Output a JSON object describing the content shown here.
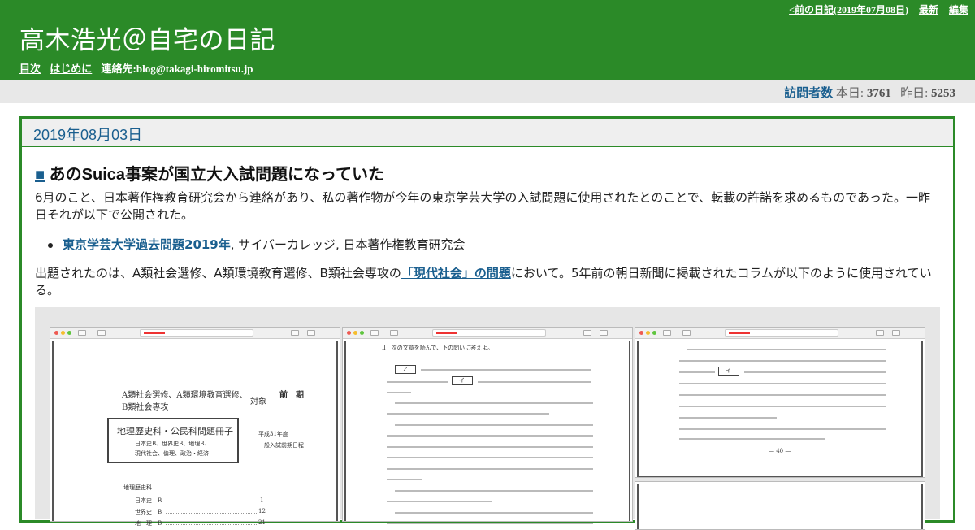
{
  "header": {
    "title": "高木浩光＠自宅の日記",
    "links": [
      "目次",
      "はじめに"
    ],
    "contact": "連絡先:blog@takagi-hiromitsu.jp",
    "nav": [
      "<前の日記(2019年07月08日)",
      "最新",
      "編集"
    ]
  },
  "counter": {
    "label": "訪問者数",
    "today_label": "本日:",
    "today": "3761",
    "yesterday_label": "昨日:",
    "yesterday": "5253"
  },
  "diary": {
    "date": "2019年08月03日",
    "section_mark": "■",
    "section_title": "あのSuica事案が国立大入試問題になっていた",
    "para1": "6月のこと、日本著作権教育研究会から連絡があり、私の著作物が今年の東京学芸大学の入試問題に使用されたとのことで、転載の許諾を求めるものであった。一昨日それが以下で公開された。",
    "bullet_link": "東京学芸大学過去問題2019年",
    "bullet_rest": ", サイバーカレッジ, 日本著作権教育研究会",
    "para2_before": "出題されたのは、A類社会選修、A類環境教育選修、B類社会専攻の",
    "para2_link": "「現代社会」の問題",
    "para2_after": "において。5年前の朝日新聞に掲載されたコラムが以下のように使用されている。"
  },
  "scan": {
    "left_heading_1": "A類社会選修、A類環境教育選修、",
    "left_heading_2": "B類社会専攻",
    "left_target": "対象",
    "left_term": "前　期",
    "left_box_title": "地理歴史科・公民科問題冊子",
    "left_box_sub_1": "日本史B、世界史B、地理B、",
    "left_box_sub_2": "現代社会、倫理、政治・経済",
    "left_year": "平成31年度",
    "left_exam": "一般入試前期日程",
    "left_toc_title": "地理歴史科",
    "left_toc_1": "日本史　B",
    "left_toc_1_page": "1",
    "left_toc_2": "世界史　B",
    "left_toc_2_page": "12",
    "left_toc_3": "地　理　B",
    "left_toc_3_page": "21",
    "mid_header": "Ⅱ　次の文章を読んで、下の問いに答えよ。",
    "mid_box_a": "ア",
    "mid_box_i": "イ",
    "right_box_i": "イ",
    "right_page": "— 40 —"
  }
}
